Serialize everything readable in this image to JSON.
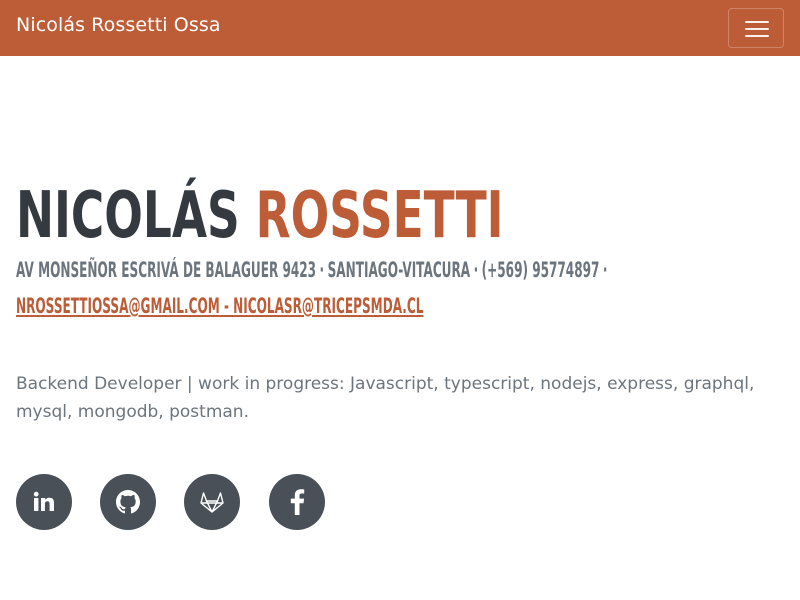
{
  "navbar": {
    "brand": "Nicolás Rossetti Ossa",
    "toggle_icon": "hamburger-menu-icon",
    "background_color": "#bd5d38"
  },
  "profile": {
    "first_name": "Nicolás",
    "last_name": "Rossetti",
    "address": "Av Monseñor Escrivá de Balaguer 9423",
    "city": "Santiago-Vitacura",
    "phone": "(+569) 95774897",
    "email_1": "nrossettiossa@gmail.com",
    "email_separator": " - ",
    "email_2": "nicolasr@tricepsmda.cl",
    "separator": "·",
    "description": "Backend Developer | work in progress: Javascript, typescript, nodejs, express, graphql, mysql, mongodb, postman."
  },
  "social": [
    {
      "icon": "linkedin-icon"
    },
    {
      "icon": "github-icon"
    },
    {
      "icon": "gitlab-icon"
    },
    {
      "icon": "facebook-icon"
    }
  ],
  "colors": {
    "accent": "#bd5d38",
    "heading": "#343a40",
    "muted": "#6c757d",
    "social_bg": "#495057"
  }
}
